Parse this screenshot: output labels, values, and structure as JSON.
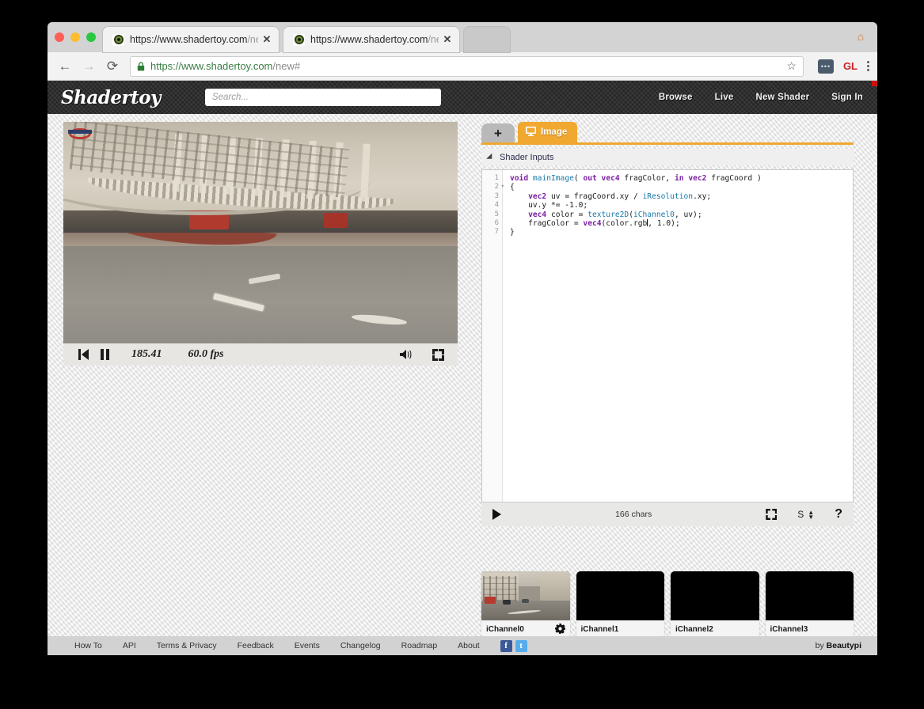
{
  "browser": {
    "tabs": [
      {
        "host": "https://www.shadertoy.com",
        "path": "/ne",
        "close": "✕",
        "favicon": "shadertoy-eye-icon",
        "active": true
      },
      {
        "host": "https://www.shadertoy.com",
        "path": "/ne",
        "close": "✕",
        "favicon": "shadertoy-eye-icon",
        "active": false
      }
    ],
    "window_badge": "⌂",
    "back_icon": "←",
    "forward_icon": "→",
    "reload_icon": "⟳",
    "lock_icon": "lock-icon",
    "url": {
      "scheme": "https://",
      "host": "www.shadertoy.com",
      "path": "/new#"
    },
    "star_icon": "☆",
    "extension_icon": "extension-icon",
    "profile_label": "GL",
    "menu_icon": "three-dot-menu-icon"
  },
  "site": {
    "logo": "Shadertoy",
    "search_placeholder": "Search...",
    "search_value": "",
    "nav": [
      {
        "label": "Browse"
      },
      {
        "label": "Live"
      },
      {
        "label": "New Shader"
      },
      {
        "label": "Sign In"
      }
    ]
  },
  "player": {
    "restart_icon": "skip-back-icon",
    "pause_icon": "pause-icon",
    "time": "185.41",
    "fps": "60.0 fps",
    "volume_icon": "speaker-icon",
    "fullscreen_icon": "fullscreen-icon"
  },
  "editor": {
    "add_tab_label": "+",
    "tab_image_label": "Image",
    "tab_image_icon": "monitor-icon",
    "shader_inputs_label": "Shader Inputs",
    "shader_inputs_toggle_icon": "triangle-collapse-icon",
    "line_numbers": [
      "1",
      "2",
      "3",
      "4",
      "5",
      "6",
      "7"
    ],
    "code_lines": [
      "void mainImage( out vec4 fragColor, in vec2 fragCoord )",
      "{",
      "    vec2 uv = fragCoord.xy / iResolution.xy;",
      "    uv.y *= -1.0;",
      "    vec4 color = texture2D(iChannel0, uv);",
      "    fragColor = vec4(color.rgb, 1.0);",
      "}"
    ],
    "char_count": "166 chars",
    "play_icon": "play-triangle-icon",
    "fullscreen_icon": "fullscreen-icon",
    "size_label": "S",
    "size_arrows_icon": "up-down-arrows-icon",
    "help_label": "?"
  },
  "channels": [
    {
      "label": "iChannel0",
      "thumb": "street-scene",
      "gear_icon": "gear-icon",
      "has_gear": true
    },
    {
      "label": "iChannel1",
      "thumb": "empty",
      "has_gear": false
    },
    {
      "label": "iChannel2",
      "thumb": "empty",
      "has_gear": false
    },
    {
      "label": "iChannel3",
      "thumb": "empty",
      "has_gear": false
    }
  ],
  "footer": {
    "links": [
      {
        "label": "How To"
      },
      {
        "label": "API"
      },
      {
        "label": "Terms & Privacy"
      },
      {
        "label": "Feedback"
      },
      {
        "label": "Events"
      },
      {
        "label": "Changelog"
      },
      {
        "label": "Roadmap"
      },
      {
        "label": "About"
      }
    ],
    "facebook_icon": "f",
    "twitter_icon": "t",
    "credit_prefix": "by ",
    "credit_name": "Beautypi"
  },
  "colors": {
    "accent_orange": "#f0a830",
    "header_dark": "#2e2e2e",
    "red_corner": "#cc1111",
    "profile_red": "#cc2222"
  }
}
